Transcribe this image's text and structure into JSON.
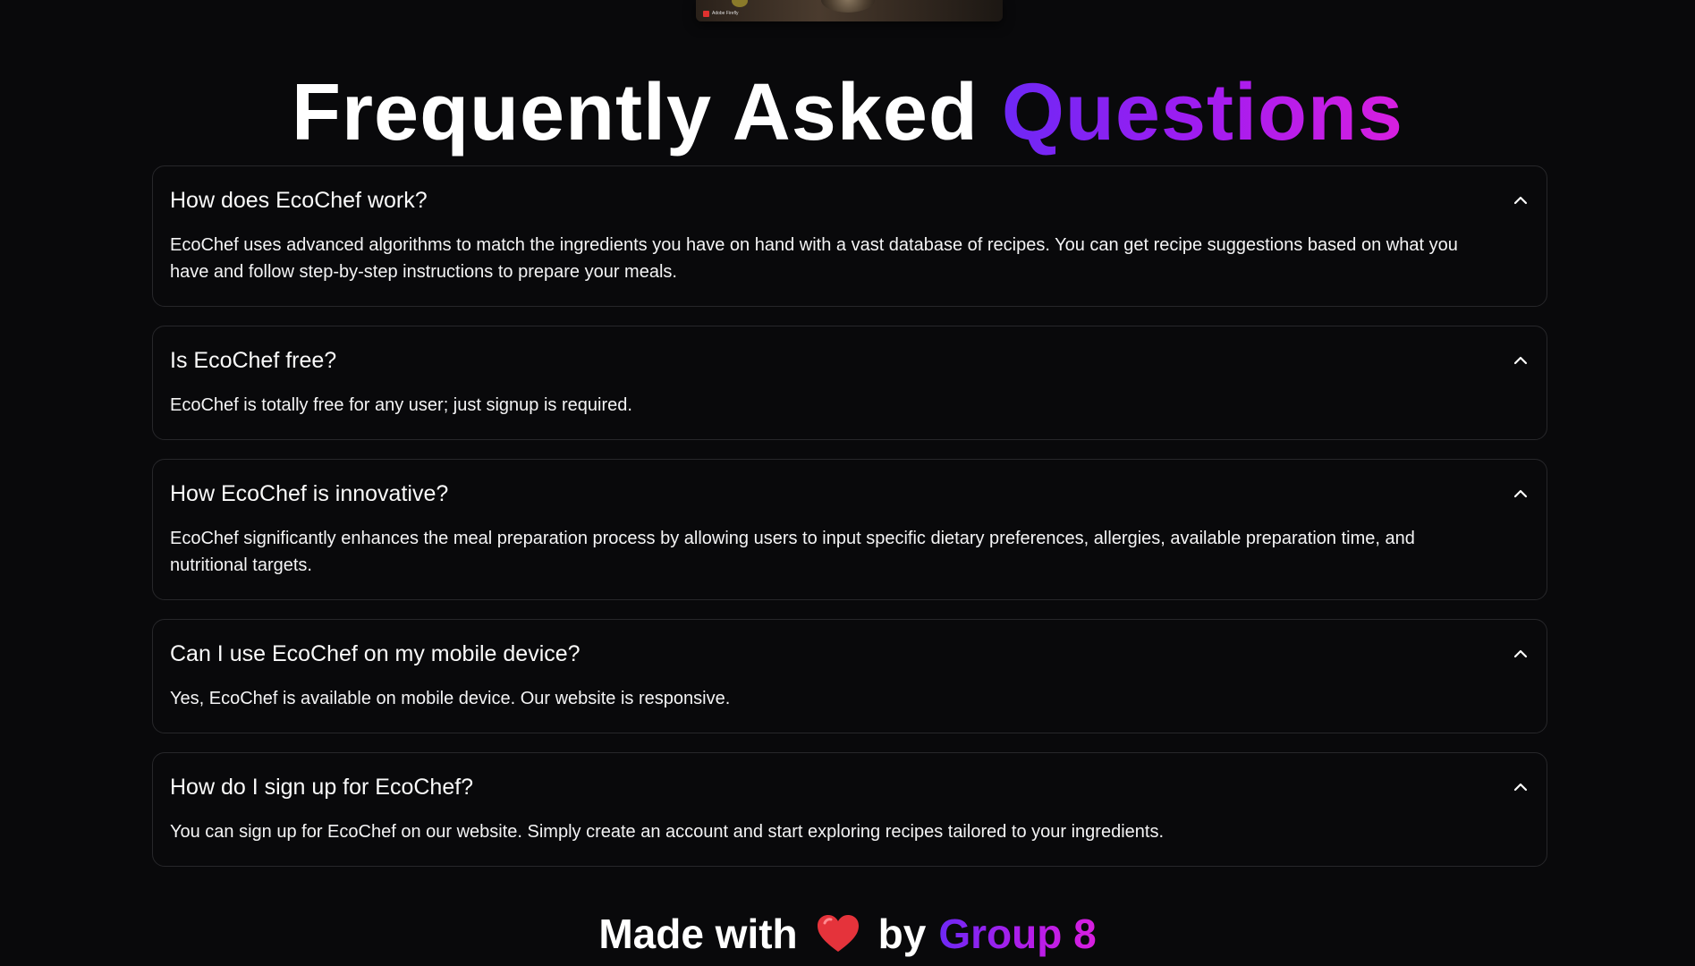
{
  "top_image": {
    "badge_text": "Adobe Firefly"
  },
  "faq": {
    "title_main": "Frequently Asked",
    "title_accent": "Questions",
    "items": [
      {
        "question": "How does EcoChef work?",
        "answer": "EcoChef uses advanced algorithms to match the ingredients you have on hand with a vast database of recipes. You can get recipe suggestions based on what you have and follow step-by-step instructions to prepare your meals."
      },
      {
        "question": "Is EcoChef free?",
        "answer": "EcoChef is totally free for any user; just signup is required."
      },
      {
        "question": "How EcoChef is innovative?",
        "answer": "EcoChef significantly enhances the meal preparation process by allowing users to input specific dietary preferences, allergies, available preparation time, and nutritional targets."
      },
      {
        "question": "Can I use EcoChef on my mobile device?",
        "answer": "Yes, EcoChef is available on mobile device. Our website is responsive."
      },
      {
        "question": "How do I sign up for EcoChef?",
        "answer": "You can sign up for EcoChef on our website. Simply create an account and start exploring recipes tailored to your ingredients."
      }
    ]
  },
  "footer": {
    "made_with": "Made with",
    "by": "by",
    "group": "Group 8",
    "heart_icon": "heart-icon"
  },
  "colors": {
    "background": "#09090b",
    "border": "#27272a",
    "accent_start": "#6d28f5",
    "accent_end": "#d81fe0",
    "heart": "#e5333b"
  }
}
